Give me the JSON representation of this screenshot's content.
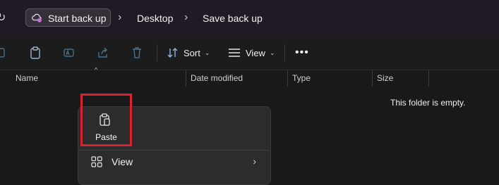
{
  "breadcrumb": {
    "items": [
      {
        "label": "Start back up"
      },
      {
        "label": "Desktop"
      },
      {
        "label": "Save back up"
      }
    ]
  },
  "toolbar": {
    "sort_label": "Sort",
    "view_label": "View",
    "icons": [
      "copy-icon",
      "paste-icon",
      "rename-icon",
      "share-icon",
      "delete-icon",
      "sort-icon",
      "view-icon",
      "more-icon"
    ]
  },
  "columns": {
    "headers": [
      "Name",
      "Date modified",
      "Type",
      "Size"
    ]
  },
  "file_list": {
    "empty_message": "This folder is empty."
  },
  "context_menu": {
    "paste_label": "Paste",
    "view_label": "View",
    "highlight_color": "#d9232e"
  }
}
